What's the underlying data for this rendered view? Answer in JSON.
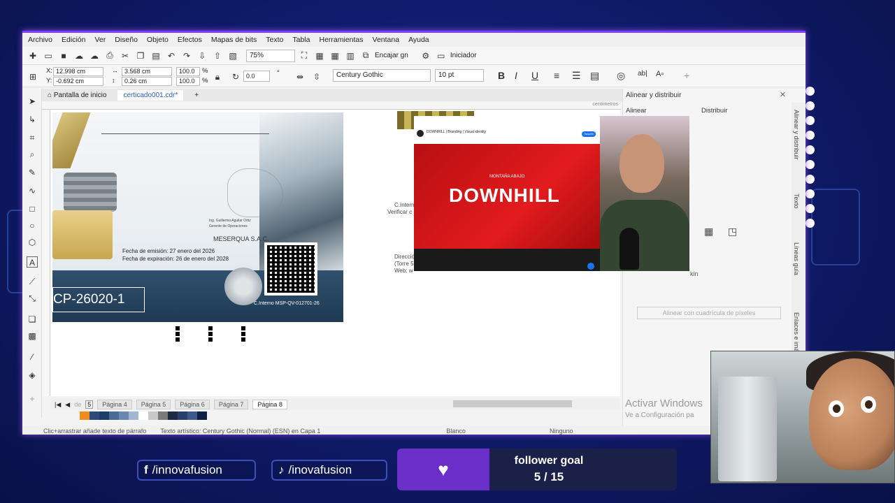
{
  "menu": [
    "Archivo",
    "Edición",
    "Ver",
    "Diseño",
    "Objeto",
    "Efectos",
    "Mapas de bits",
    "Texto",
    "Tabla",
    "Herramientas",
    "Ventana",
    "Ayuda"
  ],
  "toolbar": {
    "zoom": "75%",
    "snap_label": "Encajar gn",
    "launcher_label": "Iniciador"
  },
  "props": {
    "x": "12.998 cm",
    "y": "-0.692 cm",
    "width": "3.568 cm",
    "height": "0.26 cm",
    "scale_w": "100.0",
    "scale_h": "100.0",
    "pct": "%",
    "rotation": "0.0",
    "font_name": "Century Gothic",
    "font_size": "10 pt"
  },
  "tabs": {
    "home": "Pantalla de inicio",
    "doc": "certicado001.cdr*",
    "add": "+"
  },
  "ruler": {
    "unit": "centímetros"
  },
  "certificate": {
    "code": "CP-26020-1",
    "company": "MESERQUA S.A.C.",
    "signer": "Ing. Guillermo Aguilar Ortiz",
    "signer_role": "Gerente de Operaciones",
    "issue_date": "Fecha de emisión: 27 enero del 2026",
    "expiry_date": "Fecha de expiración: 26 de enero del 2028",
    "internal_code": "C.Interno MSP-QV-012701-26"
  },
  "canvas_texts": {
    "t1": "C.Intern",
    "t2": "Verificar c",
    "t3": "Direcció",
    "t4": "(Torre 5",
    "t5": "Web: w"
  },
  "video": {
    "channel_title": "DOWNHILL | Branding | Visual identity",
    "brand_main": "DOWNHILL",
    "brand_small": "MONTAÑA ABAJO",
    "subscribe": "Suscrib"
  },
  "docker": {
    "title": "Alinear y distribuir",
    "align": "Alinear",
    "distribute": "Distribuir",
    "grid_button": "Alinear con cuadrícula de píxeles",
    "partial_label": "kin",
    "side_tabs": [
      "Alinear y distribuir",
      "Texto",
      "Líneas guía",
      "Enlaces e imá"
    ]
  },
  "pages": {
    "count_label": "de",
    "current_num": "5",
    "tabs": [
      "Página 4",
      "Página 5",
      "Página 6",
      "Página 7",
      "Página 8"
    ],
    "active": "Página 8"
  },
  "status": {
    "hint": "Clic+arrastrar añade texto de párrafo",
    "object": "Texto artístico: Century Gothic (Normal) (ESN) en Capa 1",
    "fill": "Blanco",
    "outline": "Ninguno"
  },
  "watermark": {
    "line1": "Activar Windows",
    "line2": "Ve a Configuración pa"
  },
  "overlay": {
    "facebook": "/innovafusion",
    "tiktok": "/inovafusion",
    "goal_title": "follower goal",
    "goal_count": "5 / 15"
  },
  "palette_colors": [
    "#f28c1c",
    "#2d4a7a",
    "#1f3c66",
    "#4c6a96",
    "#6d88b0",
    "#a3b6cf",
    "#ffffff",
    "#c8c8c8",
    "#7a7a7a",
    "#1e2a44",
    "#2a3f6a",
    "#3d5a8c",
    "#102040"
  ]
}
